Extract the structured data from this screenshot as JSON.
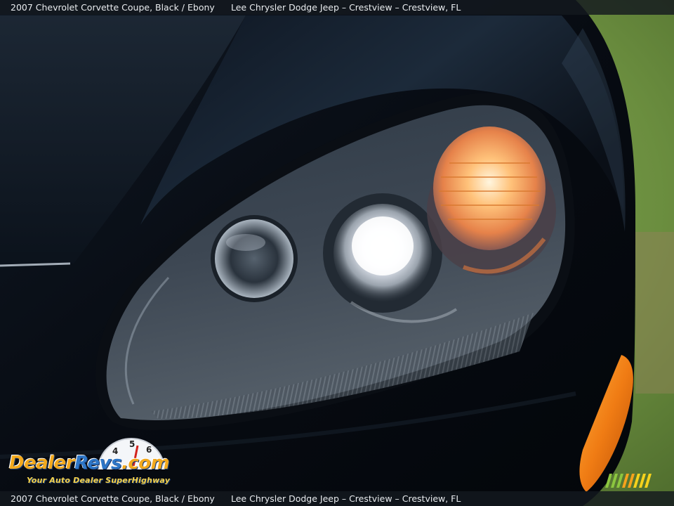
{
  "caption": {
    "vehicle": "2007 Chevrolet Corvette Coupe,  Black / Ebony",
    "dealer": "Lee Chrysler Dodge Jeep – Crestview – Crestview, FL"
  },
  "watermark": {
    "brand_dealer": "Dealer",
    "brand_revs": "Revs",
    "brand_com": ".com",
    "tagline": "Your Auto Dealer SuperHighway",
    "gauge_numbers": [
      "4",
      "5",
      "6"
    ]
  },
  "colors": {
    "paint": "#0b1018",
    "grass": "#6f9442",
    "amber_marker": "#f07c14",
    "turn_signal": "#ffb46a",
    "brand_orange": "#f3a91d",
    "brand_blue": "#2e77c8",
    "stripe_green": "#8cc63f",
    "stripe_orange": "#f6a21c"
  }
}
